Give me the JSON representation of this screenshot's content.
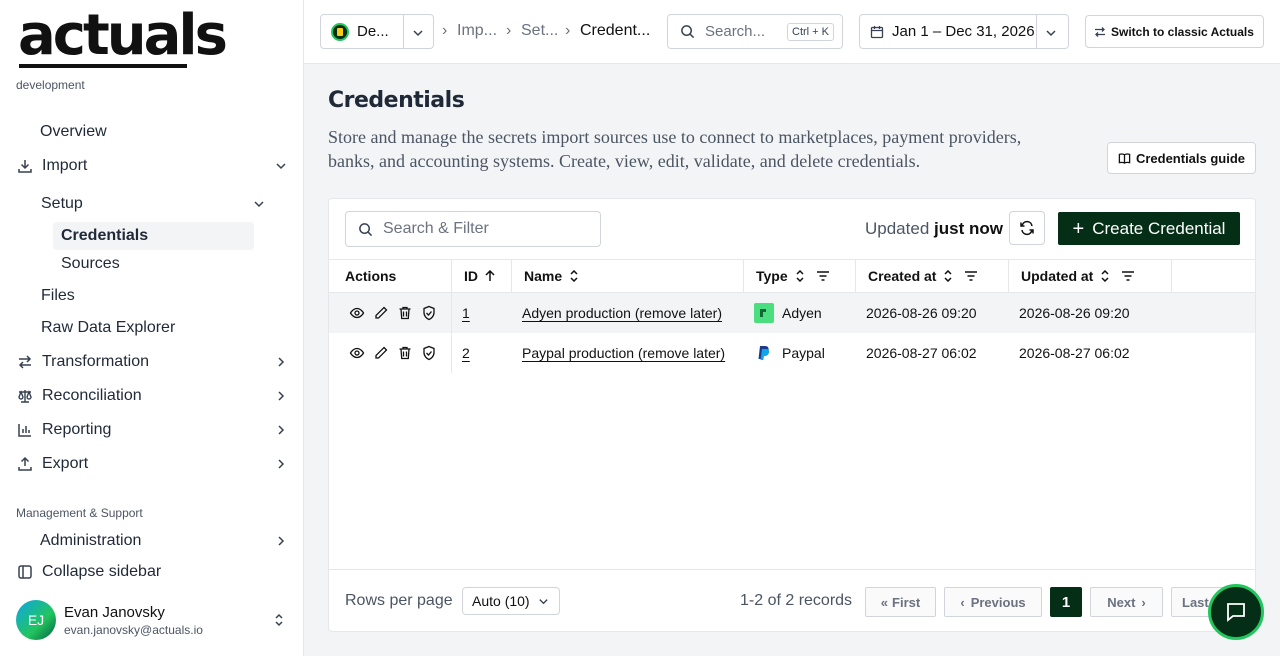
{
  "sidebar": {
    "logo": "actuals",
    "environment": "development",
    "nav": {
      "overview": "Overview",
      "import": "Import",
      "setup": "Setup",
      "credentials": "Credentials",
      "sources": "Sources",
      "files": "Files",
      "raw_data_explorer": "Raw Data Explorer",
      "transformation": "Transformation",
      "reconciliation": "Reconciliation",
      "reporting": "Reporting",
      "export": "Export"
    },
    "section_label": "Management & Support",
    "administration": "Administration",
    "collapse": "Collapse sidebar",
    "user": {
      "initials": "EJ",
      "name": "Evan Janovsky",
      "email": "evan.janovsky@actuals.io"
    }
  },
  "topbar": {
    "workspace": "De...",
    "breadcrumbs": [
      "Imp...",
      "Set...",
      "Credent..."
    ],
    "search_placeholder": "Search...",
    "shortcut": "Ctrl + K",
    "date_range": "Jan 1 – Dec 31, 2026",
    "classic_label": "Switch to classic Actuals"
  },
  "page": {
    "title": "Credentials",
    "description": "Store and manage the secrets import sources use to connect to marketplaces, payment providers, banks, and accounting systems. Create, view, edit, validate, and delete credentials.",
    "guide_label": "Credentials guide"
  },
  "table": {
    "search_placeholder": "Search & Filter",
    "updated_prefix": "Updated",
    "updated_value": "just now",
    "create_label": "Create Credential",
    "columns": [
      "Actions",
      "ID",
      "Name",
      "Type",
      "Created at",
      "Updated at"
    ],
    "rows": [
      {
        "id": "1",
        "name": "Adyen production (remove later)",
        "type": "Adyen",
        "created": "2026-08-26 09:20",
        "updated": "2026-08-26 09:20"
      },
      {
        "id": "2",
        "name": "Paypal production (remove later)",
        "type": "Paypal",
        "created": "2026-08-27 06:02",
        "updated": "2026-08-27 06:02"
      }
    ],
    "footer": {
      "rows_per_page_label": "Rows per page",
      "rows_per_page_value": "Auto (10)",
      "records": "1-2 of 2 records",
      "first": "First",
      "previous": "Previous",
      "current_page": "1",
      "next": "Next",
      "last": "Last"
    }
  },
  "colors": {
    "accent": "#052e16",
    "chat_ring": "#22c55e"
  }
}
